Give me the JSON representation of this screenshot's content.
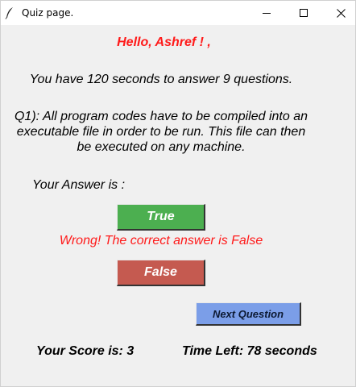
{
  "window": {
    "title": "Quiz page.",
    "icons": {
      "app": "feather-icon",
      "minimize": "minimize-icon",
      "maximize": "maximize-icon",
      "close": "close-icon"
    }
  },
  "quiz": {
    "greeting": "Hello, Ashref ! ,",
    "instructions": "You have 120 seconds to answer 9 questions.",
    "question_lines": [
      "Q1): All program codes have to be compiled into an",
      "executable file in order to be run. This file can then",
      "be executed on any machine."
    ],
    "answer_label": "Your Answer is :",
    "true_label": "True",
    "false_label": "False",
    "feedback": "Wrong! The correct answer is False",
    "next_label": "Next Question",
    "score_text": "Your Score is: 3",
    "time_left_text": "Time Left: 78 seconds"
  },
  "colors": {
    "greeting": "#ff1a1a",
    "feedback": "#ff1a1a",
    "true_button": "#4caf50",
    "false_button": "#c55a50",
    "next_button": "#7b9ee8"
  }
}
